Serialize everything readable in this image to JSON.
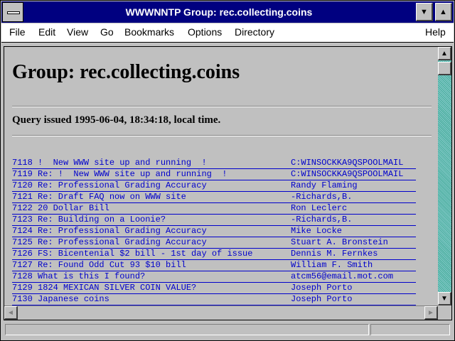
{
  "window": {
    "title": "WWWNNTP Group: rec.collecting.coins",
    "minimize_glyph": "▼",
    "maximize_glyph": "▲"
  },
  "menu": {
    "file": "File",
    "edit": "Edit",
    "view": "View",
    "go": "Go",
    "bookmarks": "Bookmarks",
    "options": "Options",
    "directory": "Directory",
    "help": "Help"
  },
  "page": {
    "heading": "Group: rec.collecting.coins",
    "query": "Query issued 1995-06-04, 18:34:18, local time."
  },
  "articles": [
    {
      "subject": "7118 !  New WWW site up and running  !",
      "author": "C:WINSOCKKA9QSPOOLMAIL"
    },
    {
      "subject": "7119 Re: !  New WWW site up and running  !",
      "author": "C:WINSOCKKA9QSPOOLMAIL"
    },
    {
      "subject": "7120 Re: Professional Grading Accuracy",
      "author": "Randy Flaming"
    },
    {
      "subject": "7121 Re: Draft FAQ now on WWW site",
      "author": "-Richards,B."
    },
    {
      "subject": "7122 20 Dollar Bill",
      "author": "Ron Leclerc"
    },
    {
      "subject": "7123 Re: Building on a Loonie?",
      "author": "-Richards,B."
    },
    {
      "subject": "7124 Re: Professional Grading Accuracy",
      "author": "Mike Locke"
    },
    {
      "subject": "7125 Re: Professional Grading Accuracy",
      "author": "Stuart A. Bronstein"
    },
    {
      "subject": "7126 FS: Bicentenial $2 bill - 1st day of issue",
      "author": "Dennis M. Fernkes"
    },
    {
      "subject": "7127 Re: Found Odd Cut 93 $10 bill",
      "author": "William F. Smith"
    },
    {
      "subject": "7128 What is this I found?",
      "author": "atcm56@email.mot.com"
    },
    {
      "subject": "7129 1824 MEXICAN SILVER COIN VALUE?",
      "author": "Joseph Porto"
    },
    {
      "subject": "7130 Japanese coins",
      "author": "Joseph Porto"
    }
  ],
  "scrollbar": {
    "up_glyph": "▲",
    "down_glyph": "▼",
    "left_glyph": "◄",
    "right_glyph": "►"
  },
  "colors": {
    "titlebar": "#000080",
    "link": "#0000cc",
    "scroll_track": "#55aa99"
  }
}
